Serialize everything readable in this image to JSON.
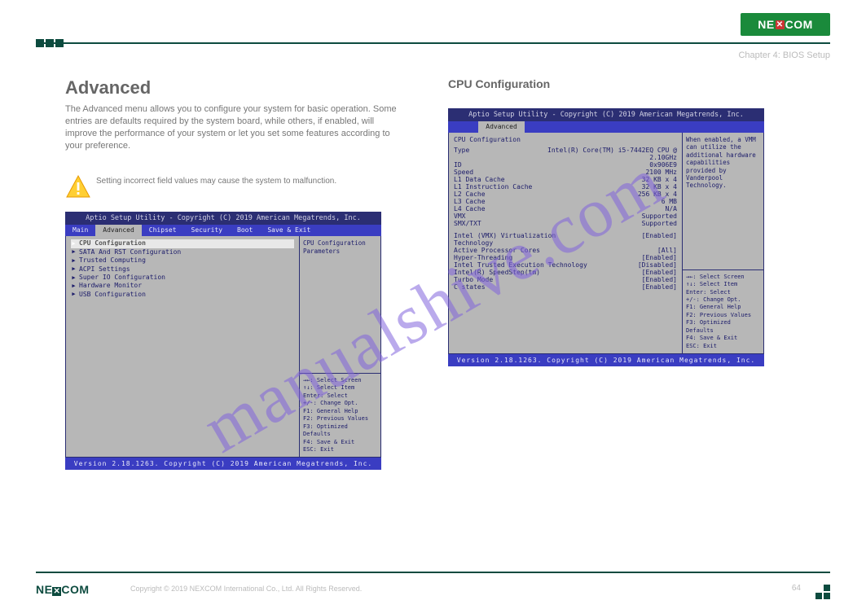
{
  "brand": "NEXCOM",
  "chapter": "Chapter 4: BIOS Setup",
  "copyright": "Copyright © 2019 NEXCOM International Co., Ltd. All Rights Reserved.",
  "page_number": "64",
  "watermark": "manualshive.com",
  "left": {
    "heading": "Advanced",
    "desc": "The Advanced menu allows you to configure your system for basic operation. Some entries are defaults required by the system board, while others, if enabled, will improve the performance of your system or let you set some features according to your preference.",
    "warning": "Setting incorrect field values may cause the system to malfunction.",
    "bios_title": "Aptio Setup Utility - Copyright (C) 2019 American Megatrends, Inc.",
    "tabs": [
      "Main",
      "Advanced",
      "Chipset",
      "Security",
      "Boot",
      "Save & Exit"
    ],
    "active_tab": "Advanced",
    "items": [
      "CPU Configuration",
      "SATA And RST Configuration",
      "Trusted Computing",
      "ACPI Settings",
      "Super IO Configuration",
      "Hardware Monitor",
      "USB Configuration"
    ],
    "side_desc": "CPU Configuration Parameters",
    "help_keys": {
      "l1": "→←: Select Screen",
      "l2": "↑↓: Select Item",
      "l3": "Enter: Select",
      "l4": "+/-: Change Opt.",
      "l5": "F1: General Help",
      "l6": "F2: Previous Values",
      "l7": "F3: Optimized Defaults",
      "l8": "F4: Save & Exit",
      "l9": "ESC: Exit"
    },
    "foot": "Version 2.18.1263. Copyright (C) 2019 American Megatrends, Inc."
  },
  "right": {
    "heading": "CPU Configuration",
    "bios_title": "Aptio Setup Utility - Copyright (C) 2019 American Megatrends, Inc.",
    "active_tab": "Advanced",
    "cpu": {
      "heading": "CPU Configuration",
      "rows": [
        {
          "k": "Type",
          "v": "Intel(R) Core(TM) i5-7442EQ CPU @ 2.10GHz"
        },
        {
          "k": "ID",
          "v": "0x906E9"
        },
        {
          "k": "Speed",
          "v": "2100 MHz"
        },
        {
          "k": "L1 Data Cache",
          "v": "32 KB x 4"
        },
        {
          "k": "L1 Instruction Cache",
          "v": "32 KB x 4"
        },
        {
          "k": "L2 Cache",
          "v": "256 KB x 4"
        },
        {
          "k": "L3 Cache",
          "v": "6 MB"
        },
        {
          "k": "L4 Cache",
          "v": "N/A"
        },
        {
          "k": "VMX",
          "v": "Supported"
        },
        {
          "k": "SMX/TXT",
          "v": "Supported"
        }
      ],
      "opts": [
        {
          "k": "Intel (VMX) Virtualization",
          "v": "[Enabled]"
        },
        {
          "k": "Technology",
          "v": ""
        },
        {
          "k": "Active Processor Cores",
          "v": "[All]"
        },
        {
          "k": "Hyper-Threading",
          "v": "[Enabled]"
        },
        {
          "k": "Intel Trusted Execution Technology",
          "v": "[Disabled]"
        },
        {
          "k": "Intel(R) SpeedStep(tm)",
          "v": "[Enabled]"
        },
        {
          "k": "Turbo Mode",
          "v": "[Enabled]"
        },
        {
          "k": "C states",
          "v": "[Enabled]"
        }
      ]
    },
    "side_desc": "When enabled, a VMM can utilize the additional hardware capabilities provided by Vanderpool Technology.",
    "help_keys": {
      "l1": "→←: Select Screen",
      "l2": "↑↓: Select Item",
      "l3": "Enter: Select",
      "l4": "+/-: Change Opt.",
      "l5": "F1: General Help",
      "l6": "F2: Previous Values",
      "l7": "F3: Optimized Defaults",
      "l8": "F4: Save & Exit",
      "l9": "ESC: Exit"
    },
    "foot": "Version 2.18.1263. Copyright (C) 2019 American Megatrends, Inc."
  }
}
